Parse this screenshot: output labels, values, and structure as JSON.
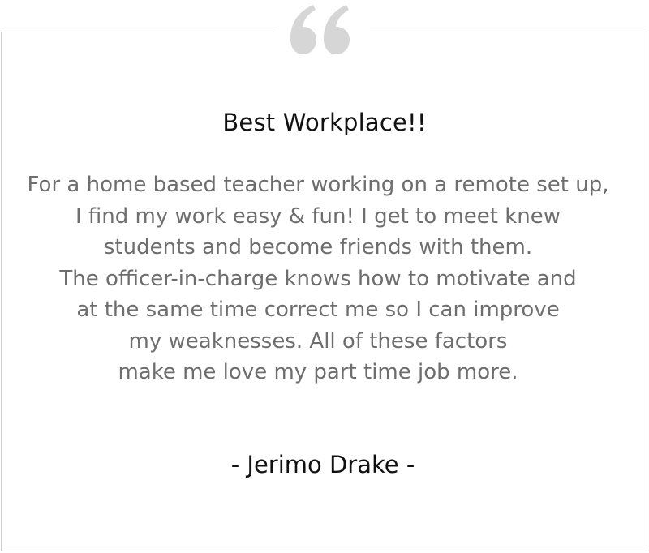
{
  "testimonial": {
    "title": "Best Workplace!!",
    "body_lines": [
      "For a home based teacher working on a remote set up,",
      "I find my work easy & fun! I get to meet knew",
      "students and become friends with them.",
      "The officer-in-charge knows how to motivate and",
      "at the same time correct me so I can improve",
      "my weaknesses. All of these factors",
      "make me love my part time job more."
    ],
    "author": "- Jerimo Drake -"
  },
  "colors": {
    "quote_icon": "#d6d6d6",
    "border": "#cfcfcf",
    "title_text": "#111111",
    "body_text": "#6e6e6e"
  },
  "icons": {
    "quote": "quote-icon"
  }
}
